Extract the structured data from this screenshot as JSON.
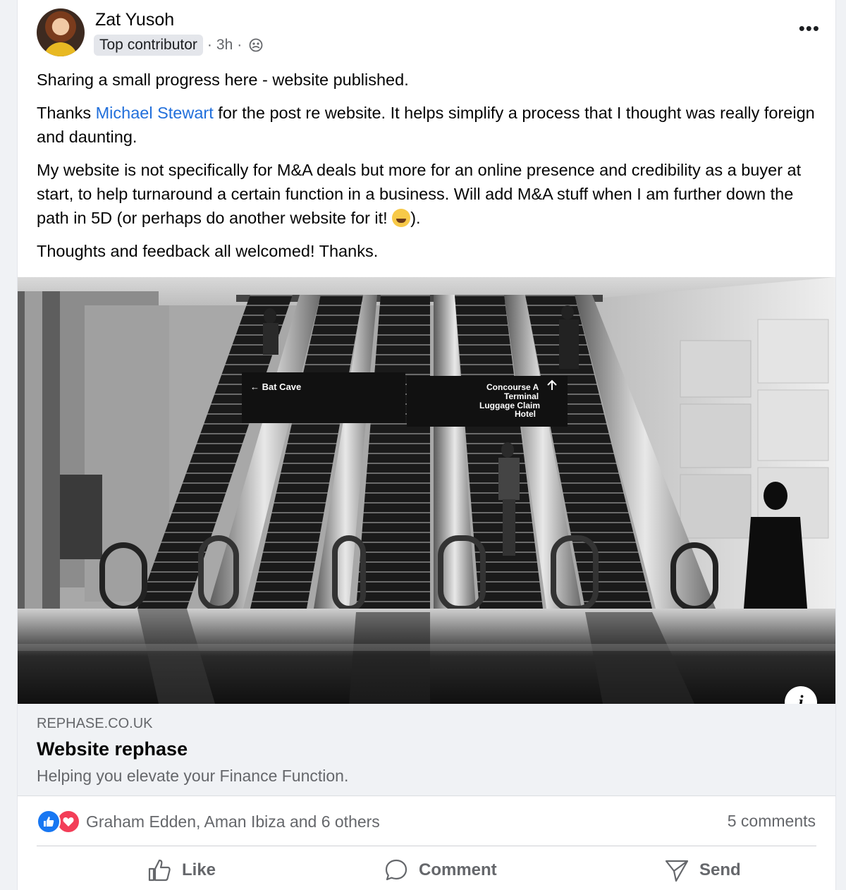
{
  "post": {
    "author": "Zat Yusoh",
    "badge": "Top contributor",
    "time": "3h",
    "privacy_icon": "group-icon",
    "more_icon": "more-horizontal-icon",
    "paragraph1": "Sharing a small progress here - website published.",
    "paragraph2_prefix": "Thanks ",
    "paragraph2_mention": "Michael Stewart",
    "paragraph2_suffix": " for the post re website. It helps simplify a process that I thought was really foreign and daunting.",
    "paragraph3_text": "My website is not specifically for M&A deals but more for an online presence and credibility as a buyer at start, to help turnaround a certain function in a business. Will add M&A stuff when I am further down the path in 5D (or perhaps do another website for it! ",
    "paragraph3_end": ").",
    "paragraph3_emoji": "grinning-sweat-emoji",
    "paragraph4": "Thoughts and feedback all welcomed! Thanks."
  },
  "image": {
    "sign_left": "Bat Cave",
    "sign_right_lines": [
      "Concourse A",
      "Terminal",
      "Luggage Claim",
      "Hotel"
    ],
    "info_icon": "info-icon",
    "info_label": "i"
  },
  "link": {
    "domain": "REPHASE.CO.UK",
    "title": "Website rephase",
    "description": "Helping you elevate your Finance Function."
  },
  "reactions": {
    "icons": [
      "like-reaction-icon",
      "love-reaction-icon"
    ],
    "names": "Graham Edden, Aman Ibiza and 6 others",
    "comments": "5 comments"
  },
  "actions": {
    "like": "Like",
    "comment": "Comment",
    "send": "Send"
  },
  "colors": {
    "mention": "#216fdb",
    "like_blue": "#1877f2",
    "love_red": "#f33e58",
    "secondary_text": "#65676b"
  }
}
